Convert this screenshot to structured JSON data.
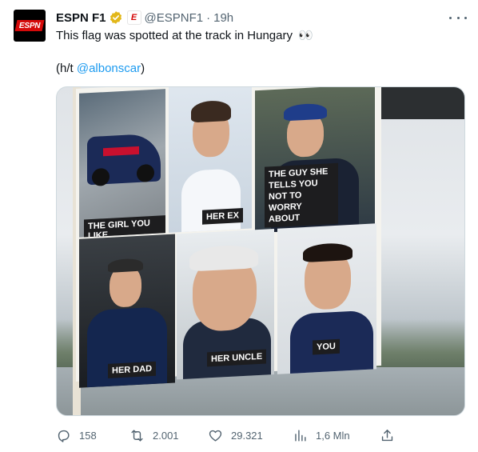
{
  "author": {
    "display_name": "ESPN F1",
    "handle": "@ESPNF1",
    "separator": "·",
    "time": "19h",
    "avatar_text": "ESPN",
    "affiliate_badge": "E"
  },
  "tweet": {
    "line1": "This flag was spotted at the track in Hungary",
    "emoji": "👀",
    "ht_prefix": "(h/t ",
    "ht_mention": "@albonscar",
    "ht_suffix": ")"
  },
  "media": {
    "panels": [
      {
        "label": "THE GIRL YOU LIKE"
      },
      {
        "label": "HER EX"
      },
      {
        "label": "THE GUY SHE TELLS YOU NOT TO WORRY ABOUT"
      },
      {
        "label": "HER DAD"
      },
      {
        "label": "HER UNCLE"
      },
      {
        "label": "YOU"
      }
    ]
  },
  "actions": {
    "replies": "158",
    "retweets": "2.001",
    "likes": "29.321",
    "views": "1,6 Mln"
  },
  "colors": {
    "text": "#0f1419",
    "secondary": "#536471",
    "link": "#1d9bf0",
    "verified_gold": "#e2b719",
    "brand_red": "#d50a0a"
  },
  "icons": [
    "verified-gold-icon",
    "more-icon",
    "reply-icon",
    "retweet-icon",
    "like-icon",
    "views-icon",
    "share-icon"
  ]
}
